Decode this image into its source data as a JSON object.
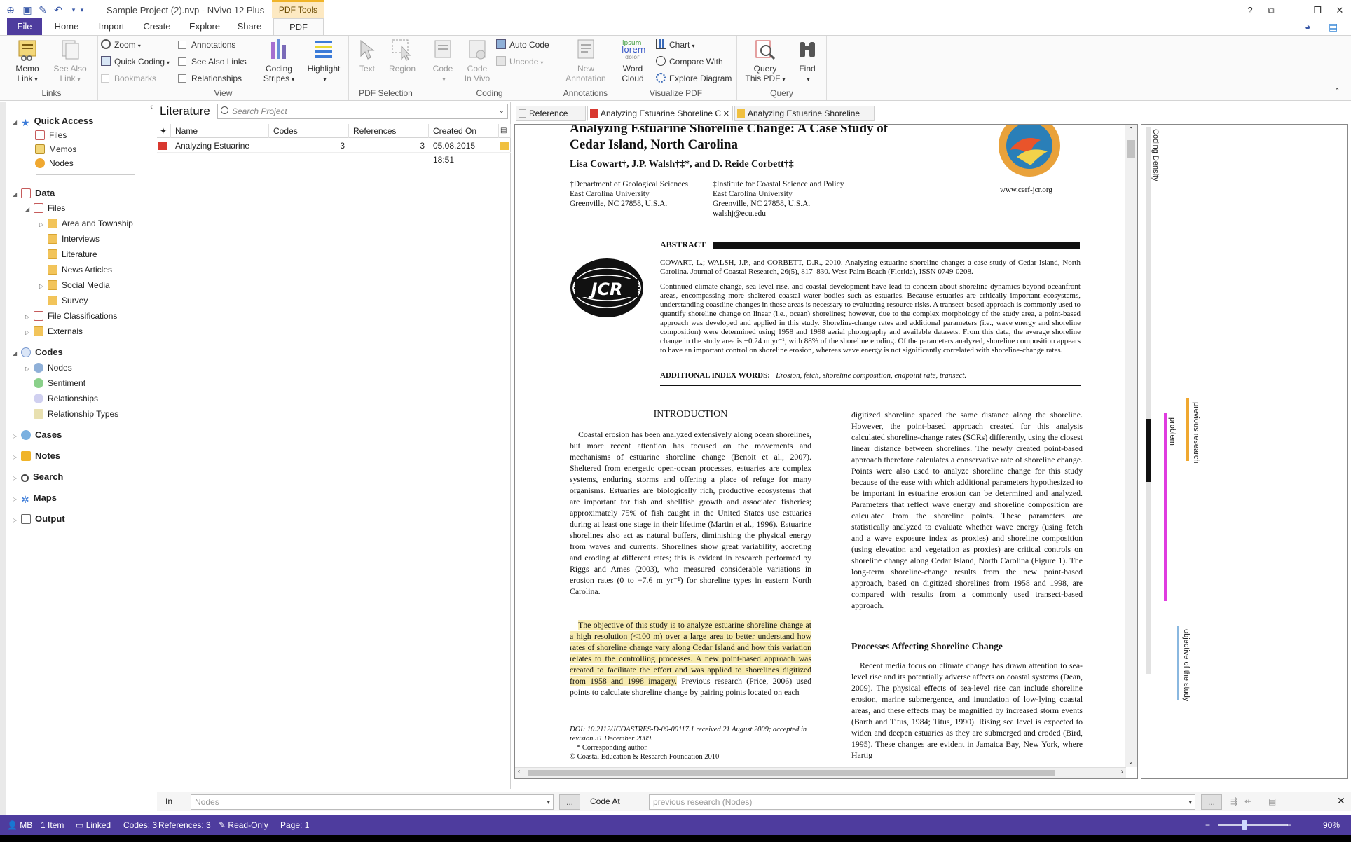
{
  "window": {
    "title": "Sample Project (2).nvp - NVivo 12 Plus",
    "context_tab": "PDF Tools"
  },
  "tabs": [
    "File",
    "Home",
    "Import",
    "Create",
    "Explore",
    "Share",
    "PDF"
  ],
  "ribbon": {
    "links": {
      "label": "Links",
      "memo_link": "Memo\nLink",
      "see_also_link": "See Also\nLink",
      "bookmarks": "Bookmarks"
    },
    "view": {
      "label": "View",
      "zoom": "Zoom",
      "quick_coding": "Quick Coding",
      "annotations": "Annotations",
      "see_also_links": "See Also Links",
      "relationships": "Relationships",
      "coding_stripes": "Coding\nStripes",
      "highlight": "Highlight"
    },
    "pdf_selection": {
      "label": "PDF Selection",
      "text": "Text",
      "region": "Region"
    },
    "coding": {
      "label": "Coding",
      "code": "Code",
      "code_in_vivo": "Code\nIn Vivo",
      "auto_code": "Auto Code",
      "uncode": "Uncode"
    },
    "annotations": {
      "label": "Annotations",
      "new_annotation": "New\nAnnotation"
    },
    "visualize": {
      "label": "Visualize PDF",
      "word_cloud": "Word\nCloud",
      "chart": "Chart",
      "compare_with": "Compare With",
      "explore_diagram": "Explore Diagram"
    },
    "query": {
      "label": "Query",
      "query_this_pdf": "Query\nThis PDF",
      "find": "Find"
    }
  },
  "nav": {
    "quick_access": "Quick Access",
    "qa_items": [
      "Files",
      "Memos",
      "Nodes"
    ],
    "data": "Data",
    "files": "Files",
    "file_folders": [
      "Area and Township",
      "Interviews",
      "Literature",
      "News Articles",
      "Social Media",
      "Survey"
    ],
    "file_classifications": "File Classifications",
    "externals": "Externals",
    "codes": "Codes",
    "code_items": [
      "Nodes",
      "Sentiment",
      "Relationships",
      "Relationship Types"
    ],
    "cases": "Cases",
    "notes": "Notes",
    "search": "Search",
    "maps": "Maps",
    "output": "Output"
  },
  "list": {
    "title": "Literature",
    "search_placeholder": "Search Project",
    "columns": [
      "Name",
      "Codes",
      "References",
      "Created On"
    ],
    "rows": [
      {
        "name": "Analyzing Estuarine",
        "codes": "3",
        "references": "3",
        "created": "05.08.2015 18:51"
      }
    ]
  },
  "doc_tabs": [
    "Reference",
    "Analyzing Estuarine Shoreline C",
    "Analyzing Estuarine Shoreline"
  ],
  "pdf": {
    "title1": "Analyzing Estuarine Shoreline Change: A Case Study of",
    "title2": "Cedar Island, North Carolina",
    "authors": "Lisa Cowart†, J.P. Walsh†‡*, and D. Reide Corbett†‡",
    "affil1": [
      "†Department of Geological Sciences",
      "East Carolina University",
      "Greenville,  NC 27858, U.S.A."
    ],
    "affil2": [
      "‡Institute for Coastal Science and Policy",
      "East Carolina University",
      "Greenville, NC 27858, U.S.A.",
      "walshj@ecu.edu"
    ],
    "site": "www.cerf-jcr.org",
    "abstract_head": "ABSTRACT",
    "citation": "COWART, L.; WALSH, J.P., and CORBETT, D.R., 2010. Analyzing estuarine shoreline change: a case study of Cedar Island, North Carolina. Journal of Coastal Research, 26(5), 817–830. West Palm Beach (Florida), ISSN 0749-0208.",
    "abstract": "Continued climate change, sea-level rise, and coastal development have lead to concern about shoreline dynamics beyond oceanfront areas, encompassing more sheltered coastal water bodies such as estuaries. Because estuaries are critically important ecosystems, understanding coastline changes in these areas is necessary to evaluating resource risks. A transect-based approach is commonly used to quantify shoreline change on linear (i.e., ocean) shorelines; however, due to the complex morphology of the study area, a point-based approach was developed and applied in this study. Shoreline-change rates and additional parameters (i.e., wave energy and shoreline composition) were determined using 1958 and 1998 aerial photography and available datasets. From this data, the average shoreline change in the study area is −0.24 m yr⁻¹, with 88% of the shoreline eroding. Of the parameters analyzed, shoreline composition appears to have an important control on shoreline erosion, whereas wave energy is not significantly correlated with shoreline-change rates.",
    "index_words_label": "ADDITIONAL INDEX WORDS:",
    "index_words": "Erosion, fetch, shoreline composition, endpoint rate, transect.",
    "intro_head": "INTRODUCTION",
    "intro_p1": "Coastal erosion has been analyzed extensively along ocean shorelines, but more recent attention has focused on the movements and mechanisms of estuarine shoreline change (Benoit et al., 2007). Sheltered from energetic open-ocean processes, estuaries are complex systems, enduring storms and offering a place of refuge for many organisms. Estuaries are biologically rich, productive ecosystems that are important for fish and shellfish growth and associated fisheries; approximately 75% of fish caught in the United States use estuaries during at least one stage in their lifetime (Martin et al., 1996). Estuarine shorelines also act as natural buffers, diminishing the physical energy from waves and currents. Shorelines show great variability, accreting and eroding at different rates; this is evident in research performed by Riggs and Ames (2003), who measured considerable variations in erosion rates (0 to −7.6 m yr⁻¹) for shoreline types in eastern North Carolina.",
    "intro_hl": "The objective of this study is to analyze estuarine shoreline change at a high resolution (<100 m) over a large area to better understand how rates of shoreline change vary along Cedar Island and how this variation relates to the controlling processes. A new point-based approach was created to facilitate the effort and was applied to shorelines digitized from 1958 and 1998 imagery.",
    "intro_p2_tail": " Previous research (Price, 2006) used points to calculate shoreline change by pairing points located on each",
    "doi": "DOI: 10.2112/JCOASTRES-D-09-00117.1 received 21 August 2009; accepted in revision 31 December 2009.",
    "corresponding": "* Corresponding author.",
    "copyright": "© Coastal Education & Research Foundation 2010",
    "col2_p1": "digitized shoreline spaced the same distance along the shoreline. However, the point-based approach created for this analysis calculated shoreline-change rates (SCRs) differently, using the closest linear distance between shorelines. The newly created point-based approach therefore calculates a conservative rate of shoreline change. Points were also used to analyze shoreline change for this study because of the ease with which additional parameters hypothesized to be important in estuarine erosion can be determined and analyzed. Parameters that reflect wave energy and shoreline composition are calculated from the shoreline points. These parameters are statistically analyzed to evaluate whether wave energy (using fetch and a wave exposure index as proxies) and shoreline composition (using elevation and vegetation as proxies) are critical controls on shoreline change along Cedar Island, North Carolina (Figure 1). The long-term shoreline-change results from the new point-based approach, based on digitized shorelines from 1958 and 1998, are compared with results from a commonly used transect-based approach.",
    "col2_head": "Processes Affecting Shoreline Change",
    "col2_p2": "Recent media focus on climate change has drawn attention to sea-level rise and its potentially adverse affects on coastal systems (Dean, 2009). The physical effects of sea-level rise can include shoreline erosion, marine submergence, and inundation of low-lying coastal areas, and these effects may be magnified by increased storm events (Barth and Titus, 1984; Titus, 1990). Rising sea level is expected to widen and deepen estuaries as they are submerged and eroded (Bird, 1995). These changes are evident in Jamaica Bay, New York, where Hartig"
  },
  "stripes": {
    "title": "Coding Density",
    "labels": [
      "previous research",
      "problem",
      "objective of the study"
    ],
    "colors": {
      "previous_research": "#f0a830",
      "problem": "#e03ce0",
      "objective": "#8ab8e0"
    }
  },
  "codebar": {
    "in_label": "In",
    "in_value": "Nodes",
    "code_at_label": "Code At",
    "code_at_value": "previous research (Nodes)"
  },
  "status": {
    "user": "MB",
    "items": "1 Item",
    "linked": "Linked",
    "codes": "Codes: 3",
    "references": "References: 3",
    "readonly": "Read-Only",
    "page": "Page: 1",
    "zoom": "90%"
  },
  "colors": {
    "accent": "#4e3c9e",
    "context": "#f0b429",
    "highlight": "#f7ebb0"
  }
}
